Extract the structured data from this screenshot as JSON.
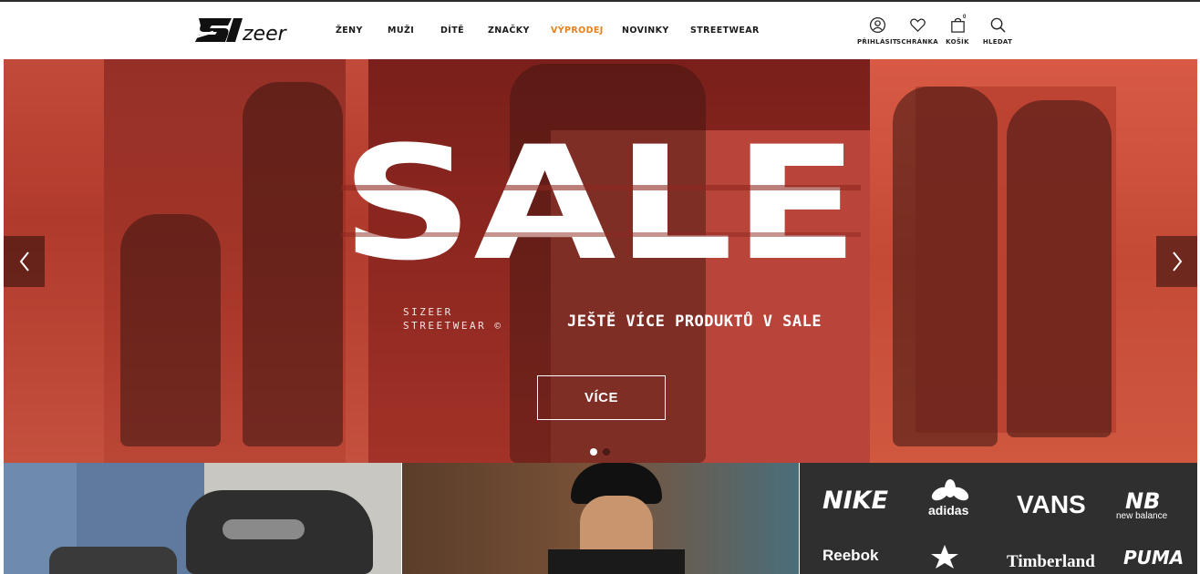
{
  "header": {
    "logo_text": "SIzeer",
    "nav": [
      {
        "label": "ŽENY",
        "id": "zeny"
      },
      {
        "label": "MUŽI",
        "id": "muzi"
      },
      {
        "label": "DÍTĚ",
        "id": "dite"
      },
      {
        "label": "ZNAČKY",
        "id": "znacky"
      },
      {
        "label": "VÝPRODEJ",
        "id": "vyprodej",
        "highlight": true
      },
      {
        "label": "NOVINKY",
        "id": "novinky"
      },
      {
        "label": "STREETWEAR",
        "id": "streetwear"
      }
    ],
    "actions": [
      {
        "label": "PŘIHLÁSIT",
        "icon": "user-icon"
      },
      {
        "label": "SCHRÁNKA",
        "icon": "heart-icon"
      },
      {
        "label": "KOŠÍK",
        "icon": "bag-icon",
        "badge": "0"
      },
      {
        "label": "HLEDAT",
        "icon": "search-icon"
      }
    ]
  },
  "hero": {
    "headline": "SALE",
    "brand_line1": "SIZEER",
    "brand_line2": "STREETWEAR ©",
    "tagline": "JEŠTĚ VÍCE PRODUKTŮ V SALE",
    "cta": "VÍCE",
    "slides_count": 2,
    "active_slide": 1
  },
  "tiles": {
    "brands": [
      "NIKE",
      "adidas",
      "VANS",
      "new balance",
      "Reebok",
      "Converse",
      "Timberland",
      "PUMA"
    ]
  },
  "colors": {
    "sale_nav": "#e8801a",
    "hero_red": "#b3392b"
  }
}
